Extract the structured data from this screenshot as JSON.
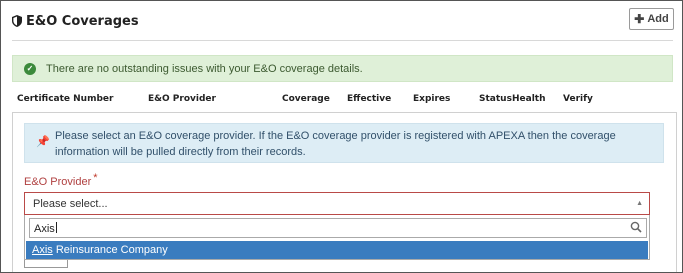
{
  "header": {
    "title": "E&O Coverages",
    "add_label": "Add"
  },
  "alerts": {
    "success": "There are no outstanding issues with your E&O coverage details.",
    "info": "Please select an E&O coverage provider. If the E&O coverage provider is registered with APEXA then the coverage information will be pulled directly from their records."
  },
  "table": {
    "columns": [
      "Certificate Number",
      "E&O Provider",
      "Coverage",
      "Effective",
      "Expires",
      "Status",
      "Health",
      "Verify"
    ]
  },
  "form": {
    "provider_label": "E&O Provider",
    "required_mark": "*",
    "select_placeholder": "Please select...",
    "search_value": "Axis",
    "option_match": "Axis",
    "option_rest": " Reinsurance Company"
  },
  "colors": {
    "success_bg": "#dff0d8",
    "info_bg": "#ddedf5",
    "error_border": "#b94a48",
    "highlight": "#3a7cbf"
  }
}
